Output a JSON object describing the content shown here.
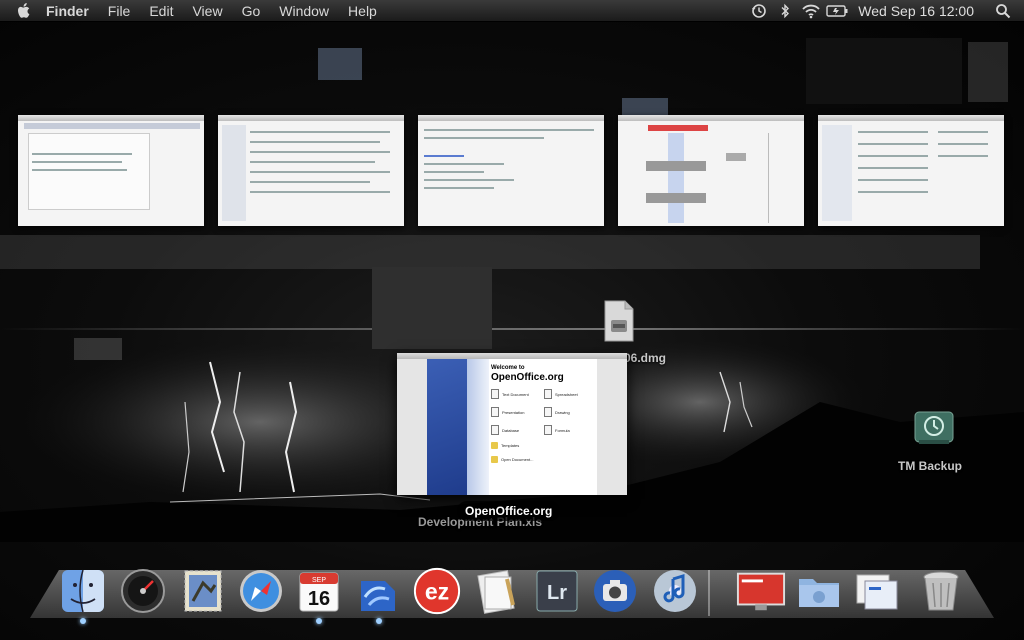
{
  "menubar": {
    "app_name": "Finder",
    "items": [
      "File",
      "Edit",
      "View",
      "Go",
      "Window",
      "Help"
    ],
    "clock": "Wed Sep 16  12:00",
    "status_icons": [
      "time-machine-icon",
      "bluetooth-icon",
      "wifi-icon",
      "battery-icon",
      "spotlight-icon"
    ]
  },
  "expose": {
    "thumbnail_count": 5,
    "focused_window_label": "OpenOffice.org"
  },
  "openoffice": {
    "welcome": "Welcome to",
    "title": "OpenOffice.org",
    "options": [
      "Text Document",
      "Spreadsheet",
      "Presentation",
      "Drawing",
      "Database",
      "Formula"
    ],
    "extras": [
      "Templates",
      "Open Document..."
    ]
  },
  "desktop": {
    "items": [
      {
        "label": "06.dmg"
      },
      {
        "label": "TM Backup"
      },
      {
        "label": "Development Plan.xls"
      }
    ]
  },
  "dock": {
    "apps": [
      "Finder",
      "Dashboard",
      "Mail",
      "Safari",
      "iCal",
      "OpenOffice.org",
      "ez",
      "Preview",
      "Lightroom",
      "iPhoto",
      "iTunes",
      "Presentation",
      "Documents",
      "Stack",
      "Trash"
    ],
    "ical_day": "16",
    "ical_month": "SEP",
    "ez_label": "ez",
    "lr_label": "Lr"
  }
}
